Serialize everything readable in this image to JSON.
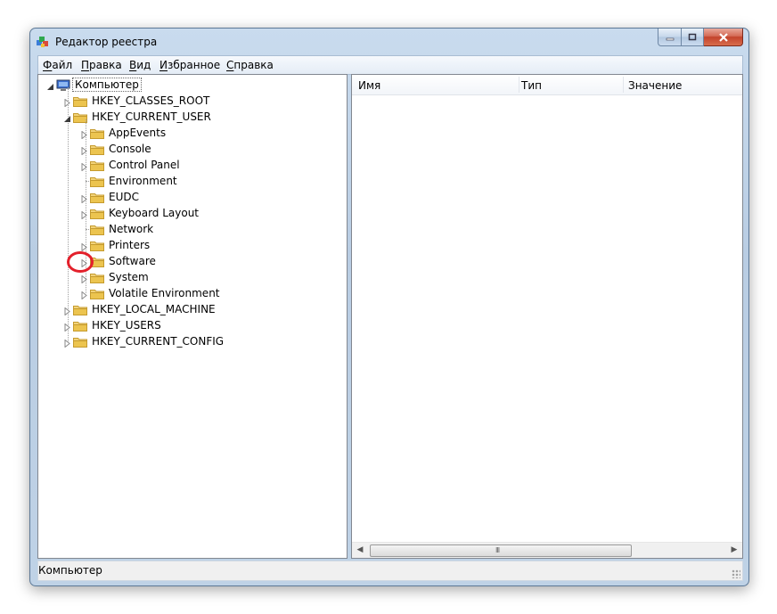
{
  "window": {
    "title": "Редактор реестра"
  },
  "menu": [
    {
      "first": "Ф",
      "rest": "айл"
    },
    {
      "first": "П",
      "rest": "равка"
    },
    {
      "first": "В",
      "rest": "ид"
    },
    {
      "first": "И",
      "rest": "збранное"
    },
    {
      "first": "С",
      "rest": "правка"
    }
  ],
  "tree": {
    "root": "Компьютер",
    "hives": [
      "HKEY_CLASSES_ROOT",
      "HKEY_CURRENT_USER",
      "HKEY_LOCAL_MACHINE",
      "HKEY_USERS",
      "HKEY_CURRENT_CONFIG"
    ],
    "current_user_children": [
      "AppEvents",
      "Console",
      "Control Panel",
      "Environment",
      "EUDC",
      "Keyboard Layout",
      "Network",
      "Printers",
      "Software",
      "System",
      "Volatile Environment"
    ]
  },
  "list": {
    "columns": [
      "Имя",
      "Тип",
      "Значение"
    ]
  },
  "status": {
    "text": "Компьютер"
  },
  "colors": {
    "highlight": "#e3202b",
    "folder": "#e8c45a"
  }
}
